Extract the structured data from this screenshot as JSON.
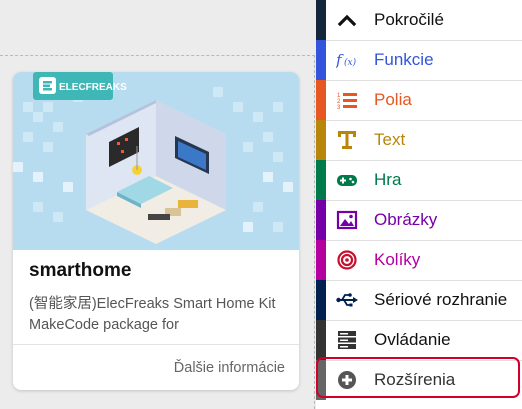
{
  "card": {
    "logo_text": "ELECFREAKS",
    "title": "smarthome",
    "description": "(智能家居)ElecFreaks Smart Home Kit MakeCode package for",
    "more_label": "Ďalšie informácie"
  },
  "toolbox": {
    "items": [
      {
        "label": "Pokročilé",
        "color": "#14263a",
        "text_color": "#111111",
        "icon": "chevron-up-icon"
      },
      {
        "label": "Funkcie",
        "color": "#3455db",
        "text_color": "#3455db",
        "icon": "function-icon"
      },
      {
        "label": "Polia",
        "color": "#e65722",
        "text_color": "#e65722",
        "icon": "list-icon"
      },
      {
        "label": "Text",
        "color": "#b8860b",
        "text_color": "#b8860b",
        "icon": "text-icon"
      },
      {
        "label": "Hra",
        "color": "#007a4b",
        "text_color": "#007a4b",
        "icon": "gamepad-icon"
      },
      {
        "label": "Obrázky",
        "color": "#7600a8",
        "text_color": "#7600a8",
        "icon": "image-icon"
      },
      {
        "label": "Kolíky",
        "color": "#b4009e",
        "text_color": "#b4009e",
        "icon": "target-icon"
      },
      {
        "label": "Sériové rozhranie",
        "color": "#002050",
        "text_color": "#111111",
        "icon": "usb-icon"
      },
      {
        "label": "Ovládanie",
        "color": "#333333",
        "text_color": "#111111",
        "icon": "server-icon"
      },
      {
        "label": "Rozšírenia",
        "color": "#666666",
        "text_color": "#333333",
        "icon": "plus-circle-icon"
      }
    ],
    "highlight_color": "#d0002b"
  }
}
